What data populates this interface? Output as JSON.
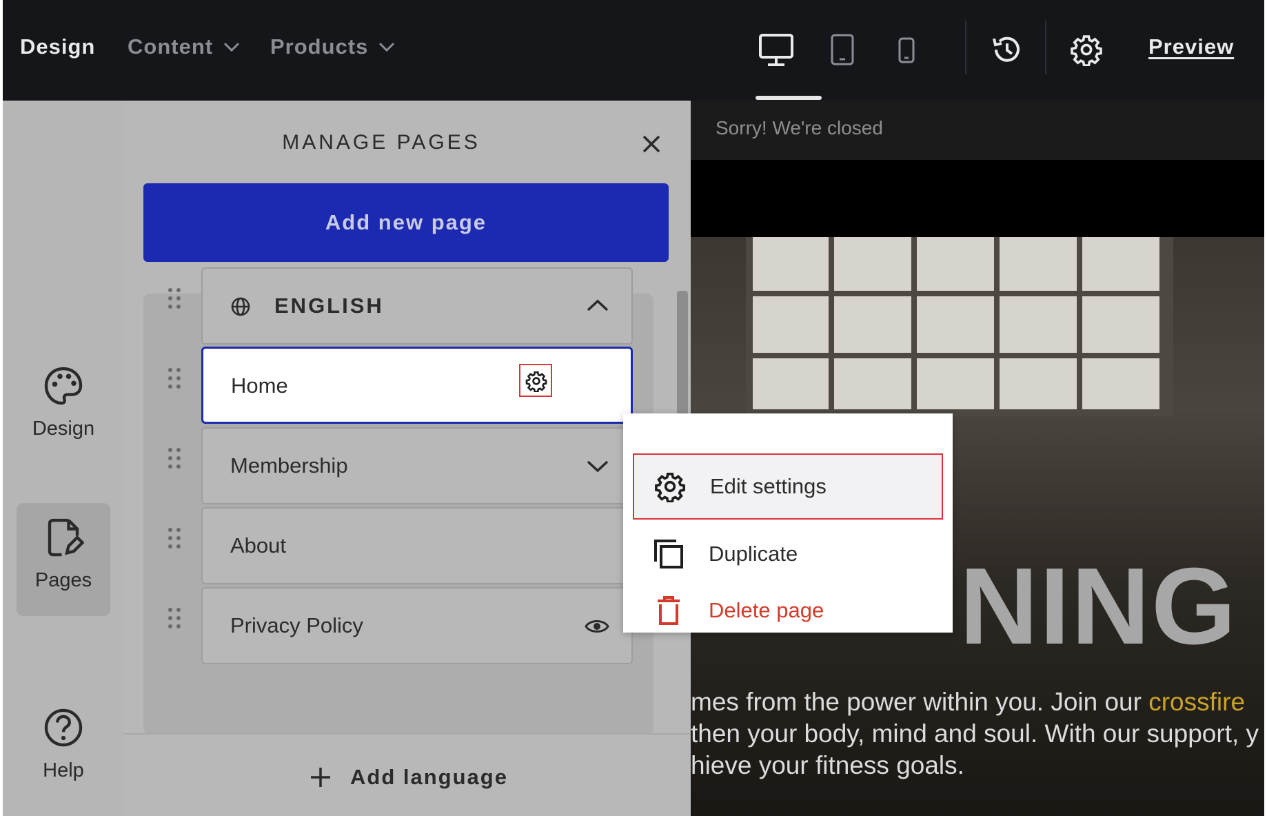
{
  "topbar": {
    "nav": [
      {
        "label": "Design"
      },
      {
        "label": "Content"
      },
      {
        "label": "Products"
      }
    ],
    "devices": [
      "desktop-icon",
      "tablet-icon",
      "mobile-icon"
    ],
    "preview_label": "Preview"
  },
  "preview_area": {
    "banner_text": "Sorry! We're closed",
    "hero_title_fragment": "NING",
    "hero_text_lines": [
      [
        "mes from the power within you. Join our ",
        "crossfire"
      ],
      [
        "then your body, mind and soul. With our support, y"
      ],
      [
        "hieve your fitness goals."
      ]
    ],
    "highlight_color": "#c9a227"
  },
  "rail": {
    "items": [
      {
        "label": "Design",
        "icon": "palette-icon"
      },
      {
        "label": "Pages",
        "icon": "page-edit-icon"
      },
      {
        "label": "Help",
        "icon": "help-icon"
      }
    ]
  },
  "panel": {
    "title": "MANAGE PAGES",
    "add_button": "Add new page",
    "language_group": "ENGLISH",
    "pages": [
      {
        "label": "Home"
      },
      {
        "label": "Membership"
      },
      {
        "label": "About"
      },
      {
        "label": "Privacy Policy"
      }
    ],
    "add_language": "Add language",
    "accent_color": "#1b2ab0"
  },
  "context_menu": {
    "items": [
      {
        "label": "Edit settings",
        "icon": "gear-icon"
      },
      {
        "label": "Duplicate",
        "icon": "copy-icon"
      },
      {
        "label": "Delete page",
        "icon": "trash-icon"
      }
    ],
    "danger_color": "#d23b2a"
  }
}
